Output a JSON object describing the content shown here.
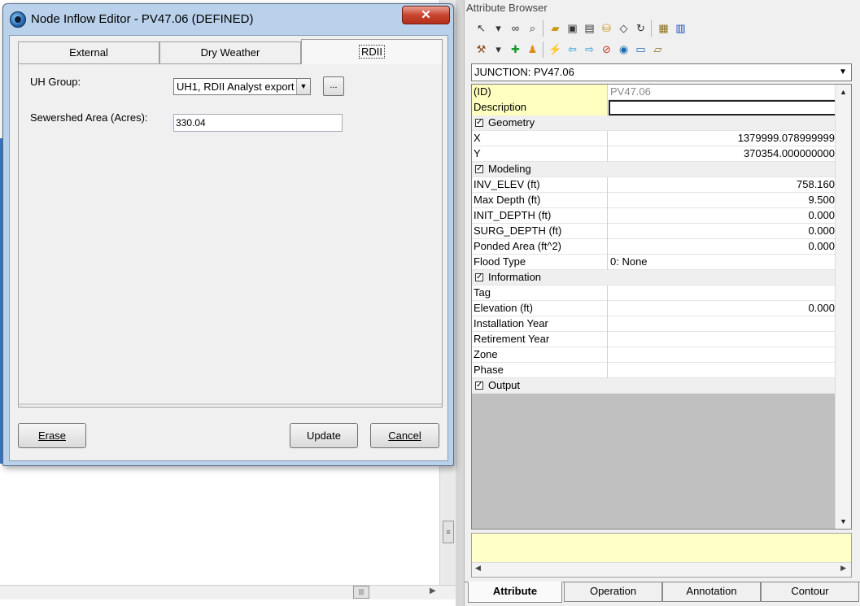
{
  "dialog": {
    "title": "Node Inflow Editor - PV47.06 (DEFINED)",
    "close_symbol": "✕",
    "tabs": [
      "External",
      "Dry Weather",
      "RDII"
    ],
    "uh_group_label": "UH Group:",
    "uh_group_value": "UH1, RDII Analyst export",
    "browse_label": "...",
    "sewershed_label": "Sewershed Area (Acres):",
    "sewershed_value": "330.04",
    "erase_label": "Erase",
    "update_label": "Update",
    "cancel_label": "Cancel"
  },
  "attribute_browser": {
    "title": "Attribute Browser",
    "element": "JUNCTION: PV47.06",
    "rows": [
      {
        "name": "(ID)",
        "value": "PV47.06",
        "type": "id"
      },
      {
        "name": "Description",
        "value": "",
        "type": "desc"
      },
      {
        "name": "Geometry",
        "type": "category"
      },
      {
        "name": "X",
        "value": "1379999.078999999",
        "align": "right"
      },
      {
        "name": "Y",
        "value": "370354.000000000",
        "align": "right"
      },
      {
        "name": "Modeling",
        "type": "category"
      },
      {
        "name": "INV_ELEV (ft)",
        "value": "758.160",
        "align": "right"
      },
      {
        "name": "Max Depth (ft)",
        "value": "9.500",
        "align": "right"
      },
      {
        "name": "INIT_DEPTH (ft)",
        "value": "0.000",
        "align": "right"
      },
      {
        "name": "SURG_DEPTH (ft)",
        "value": "0.000",
        "align": "right"
      },
      {
        "name": "Ponded Area (ft^2)",
        "value": "0.000",
        "align": "right"
      },
      {
        "name": "Flood Type",
        "value": "0: None",
        "align": "left"
      },
      {
        "name": "Information",
        "type": "category"
      },
      {
        "name": "Tag",
        "value": ""
      },
      {
        "name": "Elevation (ft)",
        "value": "0.000",
        "align": "right"
      },
      {
        "name": "Installation Year",
        "value": ""
      },
      {
        "name": "Retirement Year",
        "value": ""
      },
      {
        "name": "Zone",
        "value": ""
      },
      {
        "name": "Phase",
        "value": ""
      },
      {
        "name": "Output",
        "type": "category"
      }
    ],
    "bottom_tabs": [
      "Attribute",
      "Operation",
      "Annotation",
      "Contour"
    ],
    "toolbar1": [
      "arrow-cursor-icon",
      "dropdown-icon",
      "link-icon",
      "zoom-icon",
      "open-folder-icon",
      "save-icon",
      "save-as-icon",
      "database-icon",
      "eraser-icon",
      "refresh-icon",
      "table-icon",
      "chart-icon"
    ],
    "toolbar2": [
      "hammer-icon",
      "dropdown-icon",
      "add-node-icon",
      "person-icon",
      "pipe-tool-icon",
      "back-arrow-icon",
      "forward-arrow-icon",
      "no-zoom-icon",
      "globe-icon",
      "layer-icon",
      "open-tray-icon"
    ]
  },
  "colors": {
    "highlight": "#ffffc0",
    "dialog_frame": "#b9d1ea",
    "close_button": "#c8452f"
  }
}
